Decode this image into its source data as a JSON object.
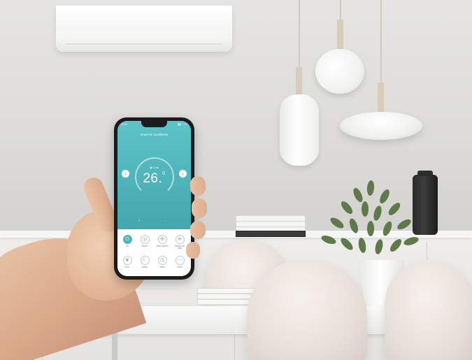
{
  "scene": {
    "subject": "hand-holding-smartphone-ac-app",
    "colors": {
      "app_accent": "#4fb3ba",
      "wall": "#e6e5e3",
      "phone_frame": "#1b1b1d"
    }
  },
  "app": {
    "status_time": "9:41",
    "status_icons": "▮▮ ◔ ▭",
    "title": "Smart Air Conditioner",
    "dial_label": "◉ Cool",
    "temperature": "26.",
    "temperature_decimal": "0",
    "left_arrow": "‹",
    "right_arrow": "›",
    "indicator_left": "≡",
    "indicator_right": "◦",
    "modes": [
      {
        "label": "On",
        "icon": "power-icon",
        "glyph": "⏻",
        "active": true
      },
      {
        "label": "Mode",
        "icon": "mode-icon",
        "glyph": "◎",
        "active": false
      },
      {
        "label": "Wind speed",
        "icon": "fan-icon",
        "glyph": "✣",
        "active": false
      },
      {
        "label": "Sweep air flow",
        "icon": "sweep-icon",
        "glyph": "≋",
        "active": false
      },
      {
        "label": "Eco",
        "icon": "eco-icon",
        "glyph": "❦",
        "active": false
      },
      {
        "label": "Sleep",
        "icon": "sleep-icon",
        "glyph": "☾",
        "active": false
      },
      {
        "label": "Timer",
        "icon": "timer-icon",
        "glyph": "◷",
        "active": false
      },
      {
        "label": "More",
        "icon": "more-icon",
        "glyph": "⋯",
        "active": false
      }
    ]
  }
}
